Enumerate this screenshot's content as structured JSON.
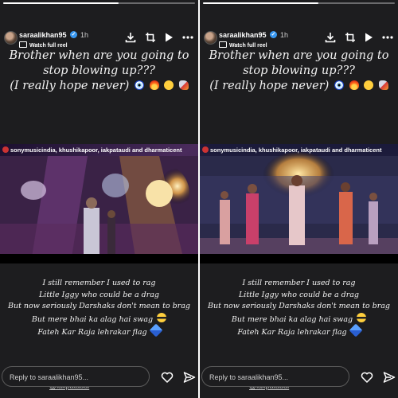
{
  "stories": [
    {
      "username": "saraalikhan95",
      "time": "1h",
      "watch_label": "Watch full reel",
      "caption_lines": [
        "Brother when are you going to",
        "stop blowing up???",
        "(I really hope never)"
      ],
      "video_credits": "sonymusicindia, khushikapoor, iakpataudi and dharmaticent",
      "video_progress": "2",
      "lyrics": [
        "I still remember I used to rag",
        "Little Iggy who could be a drag",
        "But now seriously Darshaks don't mean to brag",
        "But mere bhai ka alag hai swag",
        "Fateh Kar Raja lehrakar flag"
      ],
      "mention": "@iakpataudi",
      "reply_placeholder": "Reply to saraalikhan95..."
    },
    {
      "username": "saraalikhan95",
      "time": "1h",
      "watch_label": "Watch full reel",
      "caption_lines": [
        "Brother when are you going to",
        "stop blowing up???",
        "(I really hope never)"
      ],
      "video_credits": "sonymusicindia, khushikapoor, iakpataudi and dharmaticent",
      "video_progress": "2",
      "lyrics": [
        "I still remember I used to rag",
        "Little Iggy who could be a drag",
        "But now seriously Darshaks don't mean to brag",
        "But mere bhai ka alag hai swag",
        "Fateh Kar Raja lehrakar flag"
      ],
      "mention": "@iakpataudi",
      "reply_placeholder": "Reply to saraalikhan95..."
    }
  ],
  "icons": [
    "download-icon",
    "crop-icon",
    "play-icon",
    "more-icon",
    "heart-icon",
    "send-icon",
    "evil-eye-emoji",
    "fire-emoji",
    "smiling-face-with-hearts-emoji",
    "rocket-emoji",
    "sunglasses-emoji",
    "kite-emoji",
    "verified-badge-icon"
  ],
  "colors": {
    "story_bg": "#1d1d1f",
    "verified": "#3897f0",
    "text": "#f2f2f2"
  }
}
